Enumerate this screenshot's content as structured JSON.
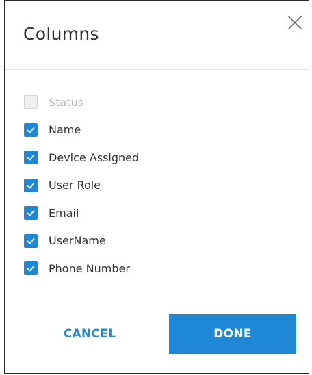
{
  "dialog": {
    "title": "Columns",
    "close_icon": "close-icon"
  },
  "columns": [
    {
      "label": "Status",
      "checked": false,
      "disabled": true
    },
    {
      "label": "Name",
      "checked": true,
      "disabled": false
    },
    {
      "label": "Device Assigned",
      "checked": true,
      "disabled": false
    },
    {
      "label": "User Role",
      "checked": true,
      "disabled": false
    },
    {
      "label": "Email",
      "checked": true,
      "disabled": false
    },
    {
      "label": "UserName",
      "checked": true,
      "disabled": false
    },
    {
      "label": "Phone Number",
      "checked": true,
      "disabled": false
    }
  ],
  "actions": {
    "cancel_label": "CANCEL",
    "done_label": "DONE"
  },
  "colors": {
    "accent": "#1e87d6",
    "cancel_text": "#2b87cf",
    "disabled_text": "#b8b8b8"
  }
}
